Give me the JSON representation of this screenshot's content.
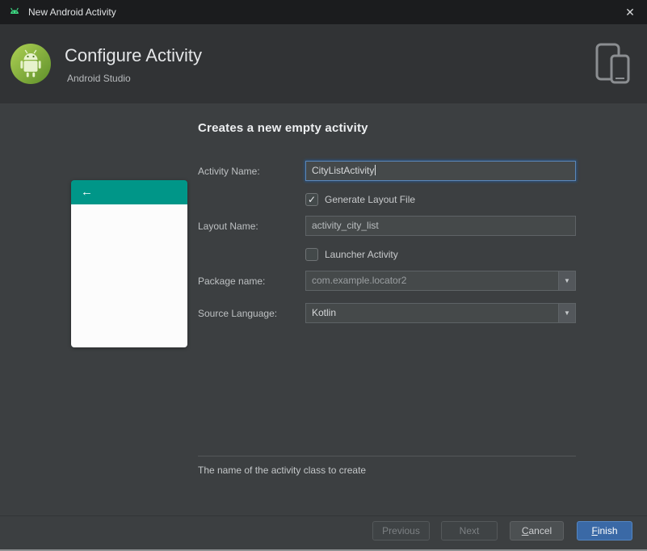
{
  "icons": {
    "close": "✕",
    "back_arrow": "←",
    "checkmark": "✓",
    "chevron_down": "▼"
  },
  "window": {
    "title": "New Android Activity"
  },
  "header": {
    "title": "Configure Activity",
    "subtitle": "Android Studio"
  },
  "content": {
    "heading": "Creates a new empty activity",
    "fields": {
      "activity_name": {
        "label": "Activity Name:",
        "value": "CityListActivity"
      },
      "generate_layout": {
        "label": "Generate Layout File",
        "checked": true
      },
      "layout_name": {
        "label": "Layout Name:",
        "value": "activity_city_list"
      },
      "launcher_activity": {
        "label": "Launcher Activity",
        "checked": false
      },
      "package_name": {
        "label": "Package name:",
        "value": "com.example.locator2"
      },
      "source_language": {
        "label": "Source Language:",
        "value": "Kotlin"
      }
    },
    "help_text": "The name of the activity class to create"
  },
  "buttons": {
    "previous": "Previous",
    "next": "Next",
    "cancel_first": "C",
    "cancel_rest": "ancel",
    "finish_first": "F",
    "finish_rest": "inish"
  },
  "colors": {
    "accent_teal": "#009688",
    "primary_button": "#3a69a6",
    "focus_border": "#5b87b8"
  }
}
